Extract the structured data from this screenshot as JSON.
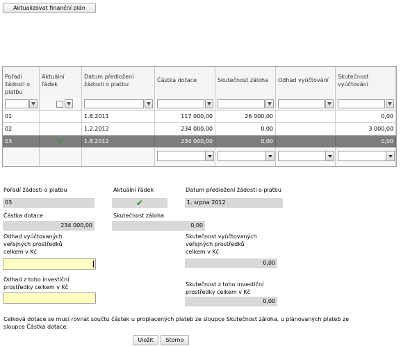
{
  "toolbar": {
    "update_plan_label": "Aktualizovat finanční plán"
  },
  "grid": {
    "columns": [
      "Pořadí žádosti o platbu",
      "Aktuální řádek",
      "Datum předložení žádosti o platbu",
      "Částka dotace",
      "Skutečnost záloha",
      "Odhad vyúčtování",
      "Skutečnost vyúčtování"
    ],
    "rows": [
      {
        "poradi": "01",
        "aktualni": "",
        "datum": "1.8.2011",
        "castka": "117 000,00",
        "zaloha": "26 000,00",
        "odhad": "",
        "vyuctovani": "0,00"
      },
      {
        "poradi": "02",
        "aktualni": "",
        "datum": "1.2.2012",
        "castka": "234 000,00",
        "zaloha": "0,00",
        "odhad": "",
        "vyuctovani": "3 000,00"
      },
      {
        "poradi": "03",
        "aktualni": "✔",
        "datum": "1.8.2012",
        "castka": "234 000,00",
        "zaloha": "0,00",
        "odhad": "",
        "vyuctovani": "0,00"
      }
    ],
    "selected_row": 2
  },
  "form": {
    "poradi_label": "Pořadí žádosti o platbu",
    "poradi_value": "03",
    "aktualni_label": "Aktuální řádek",
    "aktualni_value": "✔",
    "datum_label": "Datum předložení žádosti o platbu",
    "datum_value": "1. srpna 2012",
    "castka_label": "Částka dotace",
    "castka_value": "234 000,00",
    "zaloha_label": "Skutečnost záloha",
    "zaloha_value": "0,00",
    "odhad_verejne_label_1": "Odhad vyúčtovaných",
    "odhad_verejne_label_2": "veřejných prostředků",
    "odhad_verejne_label_3": "celkem v Kč",
    "odhad_verejne_value": "",
    "skut_verejne_label_1": "Skutečnost vyúčtovaných",
    "skut_verejne_label_2": "veřejných prostředků",
    "skut_verejne_label_3": "celkem v Kč",
    "skut_verejne_value": "0,00",
    "odhad_invest_label_1": "Odhad z toho investiční",
    "odhad_invest_label_2": "prostředky celkem v Kč",
    "odhad_invest_value": "",
    "skut_invest_label_1": "Skutečnost z toho investiční",
    "skut_invest_label_2": "prostředky celkem v Kč",
    "skut_invest_value": "0,00"
  },
  "note": {
    "line1": "Celková dotace se musí rovnat součtu částek u proplacených plateb ze sloupce Skutečnost záloha, u plánovaných plateb ze",
    "line2": "sloupce Částka dotace."
  },
  "actions": {
    "save_label": "Uložit",
    "cancel_label": "Storno"
  }
}
